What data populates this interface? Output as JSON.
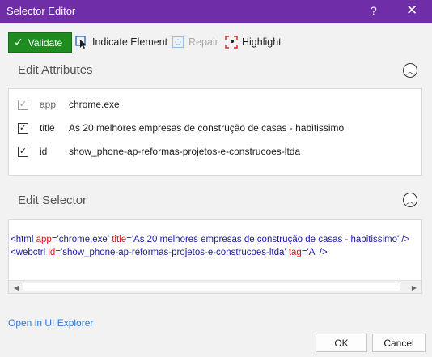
{
  "window": {
    "title": "Selector Editor",
    "help_glyph": "?",
    "close_glyph": "✕"
  },
  "toolbar": {
    "validate_label": "Validate",
    "indicate_label": "Indicate Element",
    "repair_label": "Repair",
    "highlight_label": "Highlight"
  },
  "edit_attributes": {
    "title": "Edit Attributes",
    "rows": [
      {
        "checked": true,
        "enabled": false,
        "name": "app",
        "value": "chrome.exe"
      },
      {
        "checked": true,
        "enabled": true,
        "name": "title",
        "value": "As 20 melhores empresas de construção de casas - habitissimo"
      },
      {
        "checked": true,
        "enabled": true,
        "name": "id",
        "value": "show_phone-ap-reformas-projetos-e-construcoes-ltda"
      }
    ]
  },
  "edit_selector": {
    "title": "Edit Selector",
    "line1": {
      "open": "<html ",
      "a1": "app",
      "v1": "='chrome.exe' ",
      "a2": "title",
      "v2": "='As 20 melhores empresas de construção de casas - habitissimo' />"
    },
    "line2": {
      "open": "<webctrl ",
      "a1": "id",
      "v1": "='show_phone-ap-reformas-projetos-e-construcoes-ltda' ",
      "a2": "tag",
      "v2": "='A' />"
    }
  },
  "footer": {
    "link_label": "Open in UI Explorer",
    "ok_label": "OK",
    "cancel_label": "Cancel"
  },
  "colors": {
    "titlebar": "#6f2da8",
    "validate": "#1e8c1e",
    "link": "#2d7bd6"
  }
}
